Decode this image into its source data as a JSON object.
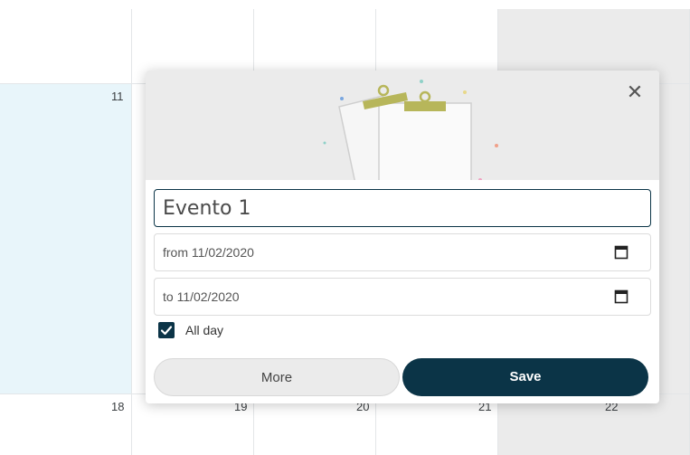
{
  "calendar": {
    "day_numbers": {
      "d11": "11",
      "d18": "18",
      "d19": "19",
      "d20": "20",
      "d21": "21",
      "d22": "22"
    }
  },
  "event_popover": {
    "title_value": "Evento 1",
    "from_text": "from 11/02/2020",
    "to_text": "to 11/02/2020",
    "all_day_label": "All day",
    "all_day_checked": true,
    "more_label": "More",
    "save_label": "Save",
    "close_icon": "✕"
  },
  "colors": {
    "primary": "#0b3447",
    "selected_week_bg": "#e8f5fa",
    "weekend_bg": "#ebebeb"
  }
}
